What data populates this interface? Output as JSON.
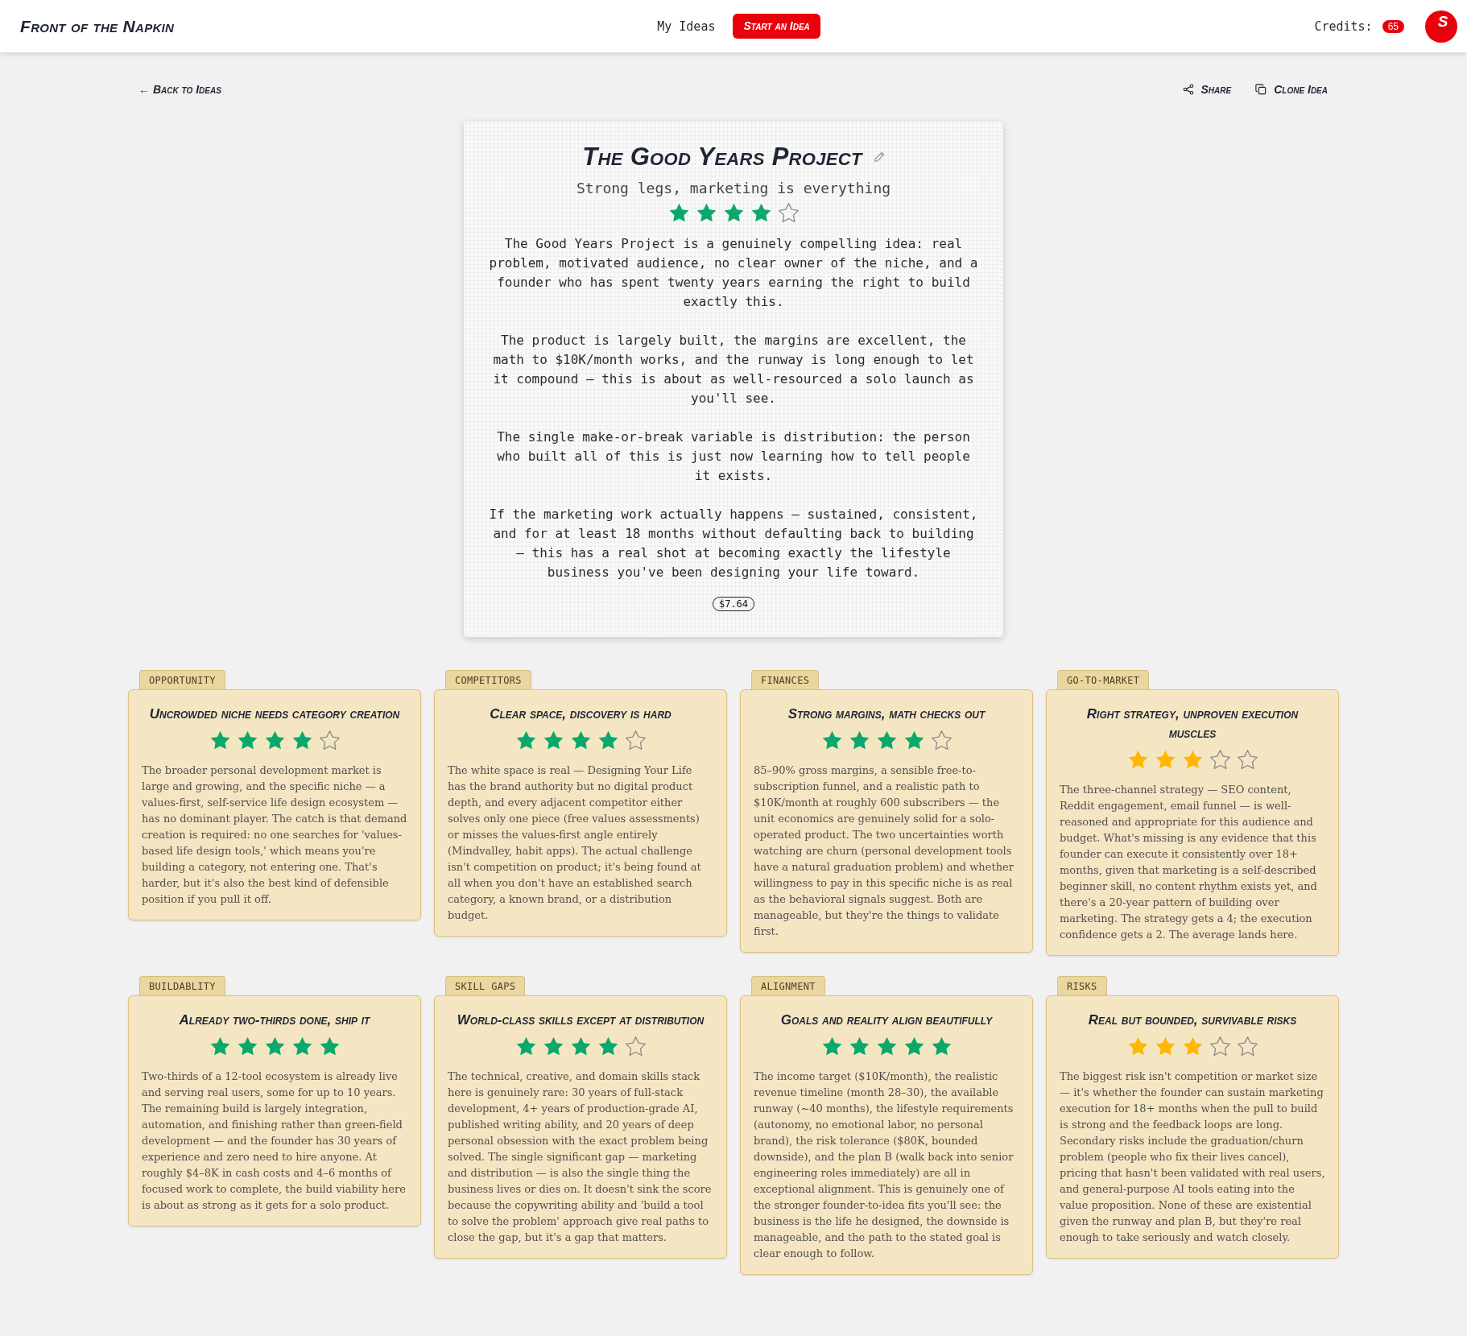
{
  "header": {
    "logo": "Front of the Napkin",
    "nav": [
      {
        "label": "My Ideas",
        "kind": "link"
      },
      {
        "label": "Start an Idea",
        "kind": "button"
      }
    ],
    "credits_label": "Credits:",
    "credits": "65",
    "avatar": "S"
  },
  "toolbar": {
    "back": "← Back to Ideas",
    "actions": [
      {
        "label": "Share",
        "kind": "share"
      },
      {
        "label": "Clone Idea",
        "kind": "clone"
      }
    ]
  },
  "idea": {
    "title": "The Good Years Project",
    "tagline": "Strong legs, marketing is everything",
    "stars": 4,
    "paragraphs": [
      "The Good Years Project is a genuinely compelling idea: real problem, motivated audience, no clear owner of the niche, and a founder who has spent twenty years earning the right to build exactly this.",
      "The product is largely built, the margins are excellent, the math to $10K/month works, and the runway is long enough to let it compound — this is about as well-resourced a solo launch as you'll see.",
      "The single make-or-break variable is distribution: the person who built all of this is just now learning how to tell people it exists.",
      "If the marketing work actually happens — sustained, consistent, and for at least 18 months without defaulting back to building — this has a real shot at becoming exactly the lifestyle business you've been designing your life toward."
    ],
    "cost": "$7.64"
  },
  "sections": [
    {
      "tag": "OPPORTUNITY",
      "title": "Uncrowded niche needs category creation",
      "stars": 4,
      "text": "The broader personal development market is large and growing, and the specific niche — a values-first, self-service life design ecosystem — has no dominant player. The catch is that demand creation is required: no one searches for 'values-based life design tools,' which means you're building a category, not entering one. That's harder, but it's also the best kind of defensible position if you pull it off."
    },
    {
      "tag": "COMPETITORS",
      "title": "Clear space, discovery is hard",
      "stars": 4,
      "text": "The white space is real — Designing Your Life has the brand authority but no digital product depth, and every adjacent competitor either solves only one piece (free values assessments) or misses the values-first angle entirely (Mindvalley, habit apps). The actual challenge isn't competition on product; it's being found at all when you don't have an established search category, a known brand, or a distribution budget."
    },
    {
      "tag": "FINANCES",
      "title": "Strong margins, math checks out",
      "stars": 4,
      "text": "85–90% gross margins, a sensible free-to-subscription funnel, and a realistic path to $10K/month at roughly 600 subscribers — the unit economics are genuinely solid for a solo-operated product. The two uncertainties worth watching are churn (personal development tools have a natural graduation problem) and whether willingness to pay in this specific niche is as real as the behavioral signals suggest. Both are manageable, but they're the things to validate first."
    },
    {
      "tag": "GO-TO-MARKET",
      "title": "Right strategy, unproven execution muscles",
      "stars": 3,
      "text": "The three-channel strategy — SEO content, Reddit engagement, email funnel — is well-reasoned and appropriate for this audience and budget. What's missing is any evidence that this founder can execute it consistently over 18+ months, given that marketing is a self-described beginner skill, no content rhythm exists yet, and there's a 20-year pattern of building over marketing. The strategy gets a 4; the execution confidence gets a 2. The average lands here."
    },
    {
      "tag": "BUILDABLITY",
      "title": "Already two-thirds done, ship it",
      "stars": 5,
      "text": "Two-thirds of a 12-tool ecosystem is already live and serving real users, some for up to 10 years. The remaining build is largely integration, automation, and finishing rather than green-field development — and the founder has 30 years of experience and zero need to hire anyone. At roughly $4–8K in cash costs and 4–6 months of focused work to complete, the build viability here is about as strong as it gets for a solo product."
    },
    {
      "tag": "SKILL GAPS",
      "title": "World-class skills except at distribution",
      "stars": 4,
      "text": "The technical, creative, and domain skills stack here is genuinely rare: 30 years of full-stack development, 4+ years of production-grade AI, published writing ability, and 20 years of deep personal obsession with the exact problem being solved. The single significant gap — marketing and distribution — is also the single thing the business lives or dies on. It doesn't sink the score because the copywriting ability and 'build a tool to solve the problem' approach give real paths to close the gap, but it's a gap that matters."
    },
    {
      "tag": "ALIGNMENT",
      "title": "Goals and reality align beautifully",
      "stars": 5,
      "text": "The income target ($10K/month), the realistic revenue timeline (month 28–30), the available runway (~40 months), the lifestyle requirements (autonomy, no emotional labor, no personal brand), the risk tolerance ($80K, bounded downside), and the plan B (walk back into senior engineering roles immediately) are all in exceptional alignment. This is genuinely one of the stronger founder-to-idea fits you'll see: the business is the life he designed, the downside is manageable, and the path to the stated goal is clear enough to follow."
    },
    {
      "tag": "RISKS",
      "title": "Real but bounded, survivable risks",
      "stars": 3,
      "text": "The biggest risk isn't competition or market size — it's whether the founder can sustain marketing execution for 18+ months when the pull to build is strong and the feedback loops are long. Secondary risks include the graduation/churn problem (people who fix their lives cancel), pricing that hasn't been validated with real users, and general-purpose AI tools eating into the value proposition. None of these are existential given the runway and plan B, but they're real enough to take seriously and watch closely."
    }
  ]
}
